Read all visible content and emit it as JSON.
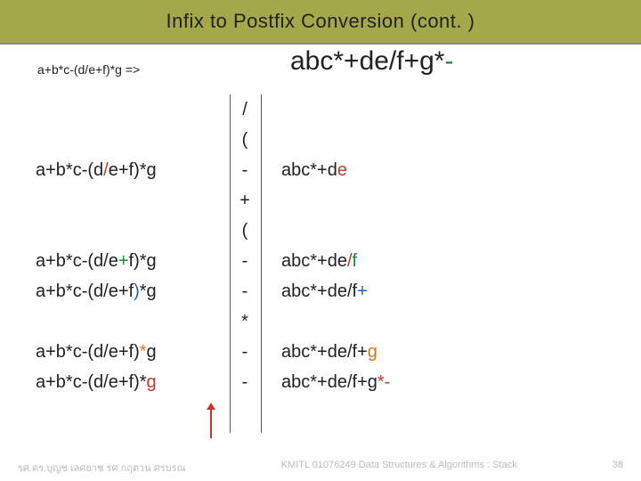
{
  "title": "Infix to Postfix Conversion  (cont. )",
  "small_expr": "a+b*c-(d/e+f)*g =>",
  "big_result_parts": [
    "abc*+de/f+g*",
    "-"
  ],
  "stack_rows": [
    {
      "left": "",
      "mid": "/",
      "right": ""
    },
    {
      "left": "",
      "mid": "(",
      "right": ""
    },
    {
      "left_parts": [
        "a+b*c-(d",
        "/",
        "e+f)*g"
      ],
      "mid": "-",
      "right_parts": [
        "abc*+d",
        "e"
      ]
    },
    {
      "left": "",
      "mid": "+",
      "right": ""
    },
    {
      "left": "",
      "mid": "(",
      "right": ""
    },
    {
      "left_parts": [
        "a+b*c-(d/e",
        "+",
        "f)*g"
      ],
      "mid": "-",
      "right_parts": [
        "abc*+de",
        "/",
        "f"
      ]
    },
    {
      "left_parts": [
        "a+b*c-(d/e+f",
        ")",
        "*g"
      ],
      "mid": "-",
      "right_parts": [
        "abc*+de/f",
        "+"
      ]
    },
    {
      "left": "",
      "mid": "*",
      "right": ""
    },
    {
      "left_parts": [
        "a+b*c-(d/e+f)",
        "*",
        "g"
      ],
      "mid": "-",
      "right_parts": [
        "abc*+de/f+",
        "g"
      ]
    },
    {
      "left_parts": [
        "a+b*c-(d/e+f)*",
        "g"
      ],
      "mid": "-",
      "right_parts": [
        "abc*+de/f+g",
        "*-"
      ]
    }
  ],
  "footer_left": "รศ.ดร.บุญช     เลศยาช     รศ.กฤตวน   ศรบรณ",
  "footer_mid": "KMITL   01076249 Data Structures & Algorithms : Stack",
  "footer_page": "38"
}
